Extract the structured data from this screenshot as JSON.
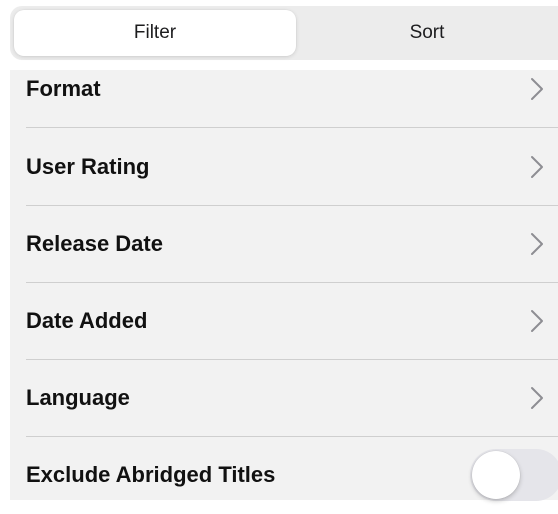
{
  "tabs": [
    {
      "label": "Filter",
      "selected": true
    },
    {
      "label": "Sort",
      "selected": false
    }
  ],
  "rows": [
    {
      "label": "Format",
      "icon": "chevron-right-icon"
    },
    {
      "label": "User Rating",
      "icon": "chevron-right-icon"
    },
    {
      "label": "Release Date",
      "icon": "chevron-right-icon"
    },
    {
      "label": "Date Added",
      "icon": "chevron-right-icon"
    },
    {
      "label": "Language",
      "icon": "chevron-right-icon"
    }
  ],
  "toggle_row": {
    "label": "Exclude Abridged Titles",
    "on": false
  },
  "colors": {
    "list_background": "#f2f2f2",
    "segment_background": "#ececec",
    "chevron": "#8e8e93",
    "toggle_off": "#e5e5ea"
  }
}
